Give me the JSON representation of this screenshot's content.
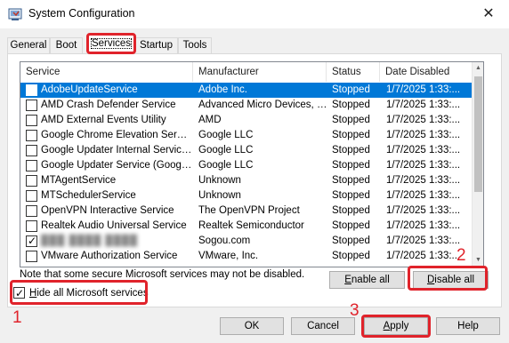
{
  "window": {
    "title": "System Configuration",
    "close_glyph": "✕"
  },
  "tabs": [
    {
      "label": "General"
    },
    {
      "label": "Boot"
    },
    {
      "label": "Services"
    },
    {
      "label": "Startup"
    },
    {
      "label": "Tools"
    }
  ],
  "services_list": {
    "columns": [
      "Service",
      "Manufacturer",
      "Status",
      "Date Disabled"
    ],
    "rows": [
      {
        "checked": false,
        "name": "AdobeUpdateService",
        "manufacturer": "Adobe Inc.",
        "status": "Stopped",
        "date": "1/7/2025 1:33:...",
        "selected": true
      },
      {
        "checked": false,
        "name": "AMD Crash Defender Service",
        "manufacturer": "Advanced Micro Devices, I...",
        "status": "Stopped",
        "date": "1/7/2025 1:33:..."
      },
      {
        "checked": false,
        "name": "AMD External Events Utility",
        "manufacturer": "AMD",
        "status": "Stopped",
        "date": "1/7/2025 1:33:..."
      },
      {
        "checked": false,
        "name": "Google Chrome Elevation Servic...",
        "manufacturer": "Google LLC",
        "status": "Stopped",
        "date": "1/7/2025 1:33:..."
      },
      {
        "checked": false,
        "name": "Google Updater Internal Service...",
        "manufacturer": "Google LLC",
        "status": "Stopped",
        "date": "1/7/2025 1:33:..."
      },
      {
        "checked": false,
        "name": "Google Updater Service (Google...",
        "manufacturer": "Google LLC",
        "status": "Stopped",
        "date": "1/7/2025 1:33:..."
      },
      {
        "checked": false,
        "name": "MTAgentService",
        "manufacturer": "Unknown",
        "status": "Stopped",
        "date": "1/7/2025 1:33:..."
      },
      {
        "checked": false,
        "name": "MTSchedulerService",
        "manufacturer": "Unknown",
        "status": "Stopped",
        "date": "1/7/2025 1:33:..."
      },
      {
        "checked": false,
        "name": "OpenVPN Interactive Service",
        "manufacturer": "The OpenVPN Project",
        "status": "Stopped",
        "date": "1/7/2025 1:33:..."
      },
      {
        "checked": false,
        "name": "Realtek Audio Universal Service",
        "manufacturer": "Realtek Semiconductor",
        "status": "Stopped",
        "date": "1/7/2025 1:33:..."
      },
      {
        "checked": true,
        "name": "",
        "blurred": true,
        "manufacturer": "Sogou.com",
        "status": "Stopped",
        "date": "1/7/2025 1:33:..."
      },
      {
        "checked": false,
        "name": "VMware Authorization Service",
        "manufacturer": "VMware, Inc.",
        "status": "Stopped",
        "date": "1/7/2025 1:33:..."
      }
    ]
  },
  "note": "Note that some secure Microsoft services may not be disabled.",
  "buttons": {
    "enable_all": "Enable all",
    "disable_all": "Disable all",
    "ok": "OK",
    "cancel": "Cancel",
    "apply": "Apply",
    "help": "Help"
  },
  "hide_ms": {
    "label": "Hide all Microsoft services",
    "checked": true
  },
  "annotations": {
    "step1": "1",
    "step2": "2",
    "step3": "3",
    "color": "#e0232b"
  }
}
